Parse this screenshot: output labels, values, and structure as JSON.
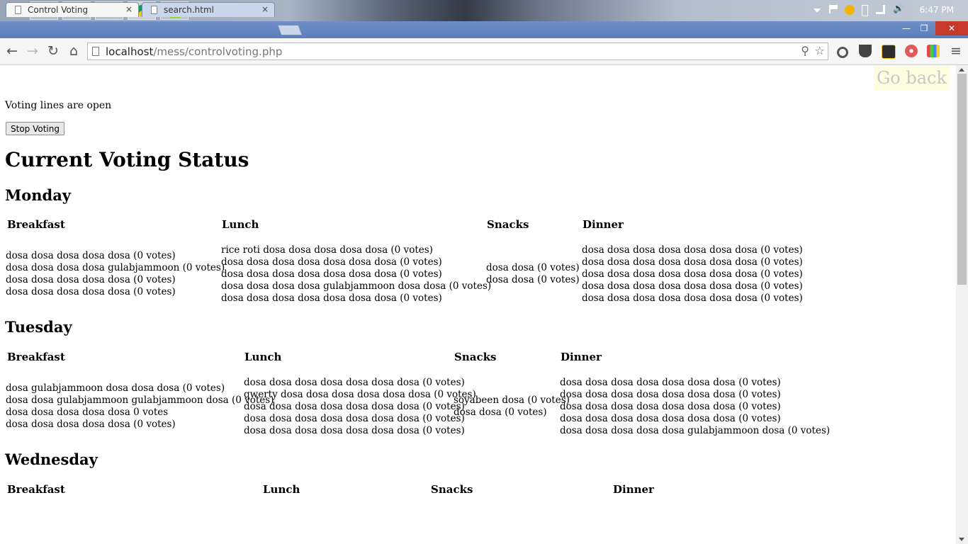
{
  "taskbar": {
    "clock": "6:47 PM"
  },
  "tabs": [
    {
      "label": "Control Voting",
      "close": "×"
    },
    {
      "label": "search.html",
      "close": "×"
    }
  ],
  "window_controls": {
    "minimize": "—",
    "restore": "❐",
    "close": "✕"
  },
  "toolbar": {
    "url_host": "localhost",
    "url_path": "/mess/controlvoting.php"
  },
  "page": {
    "go_back": "Go back",
    "status": "Voting lines are open",
    "stop_button": "Stop Voting",
    "title": "Current Voting Status",
    "meal_headers": [
      "Breakfast",
      "Lunch",
      "Snacks",
      "Dinner"
    ],
    "days": [
      {
        "name": "Monday",
        "breakfast": [
          "dosa dosa dosa dosa dosa (0 votes)",
          "dosa dosa dosa dosa gulabjammoon (0 votes)",
          "dosa dosa dosa dosa dosa (0 votes)",
          "dosa dosa dosa dosa dosa (0 votes)"
        ],
        "lunch": [
          "rice roti dosa dosa dosa dosa dosa (0 votes)",
          "dosa dosa dosa dosa dosa dosa dosa (0 votes)",
          "dosa dosa dosa dosa dosa dosa dosa (0 votes)",
          "dosa dosa dosa dosa gulabjammoon dosa dosa (0 votes)",
          "dosa dosa dosa dosa dosa dosa dosa (0 votes)"
        ],
        "snacks": [
          "dosa dosa (0 votes)",
          "dosa dosa (0 votes)"
        ],
        "dinner": [
          "dosa dosa dosa dosa dosa dosa dosa (0 votes)",
          "dosa dosa dosa dosa dosa dosa dosa (0 votes)",
          "dosa dosa dosa dosa dosa dosa dosa (0 votes)",
          "dosa dosa dosa dosa dosa dosa dosa (0 votes)",
          "dosa dosa dosa dosa dosa dosa dosa (0 votes)"
        ]
      },
      {
        "name": "Tuesday",
        "breakfast": [
          "dosa gulabjammoon dosa dosa dosa (0 votes)",
          "dosa dosa gulabjammoon gulabjammoon dosa (0 votes)",
          "dosa dosa dosa dosa dosa 0 votes",
          "dosa dosa dosa dosa dosa (0 votes)"
        ],
        "lunch": [
          "dosa dosa dosa dosa dosa dosa dosa (0 votes)",
          "qwerty dosa dosa dosa dosa dosa dosa (0 votes)",
          "dosa dosa dosa dosa dosa dosa dosa (0 votes)",
          "dosa dosa dosa dosa dosa dosa dosa (0 votes)",
          "dosa dosa dosa dosa dosa dosa dosa (0 votes)"
        ],
        "snacks": [
          "soyabeen dosa (0 votes)",
          "dosa dosa (0 votes)"
        ],
        "dinner": [
          "dosa dosa dosa dosa dosa dosa dosa (0 votes)",
          "dosa dosa dosa dosa dosa dosa dosa (0 votes)",
          "dosa dosa dosa dosa dosa dosa dosa (0 votes)",
          "dosa dosa dosa dosa dosa dosa dosa (0 votes)",
          "dosa dosa dosa dosa dosa gulabjammoon dosa (0 votes)"
        ]
      },
      {
        "name": "Wednesday",
        "breakfast": [],
        "lunch": [],
        "snacks": [],
        "dinner": []
      }
    ]
  }
}
